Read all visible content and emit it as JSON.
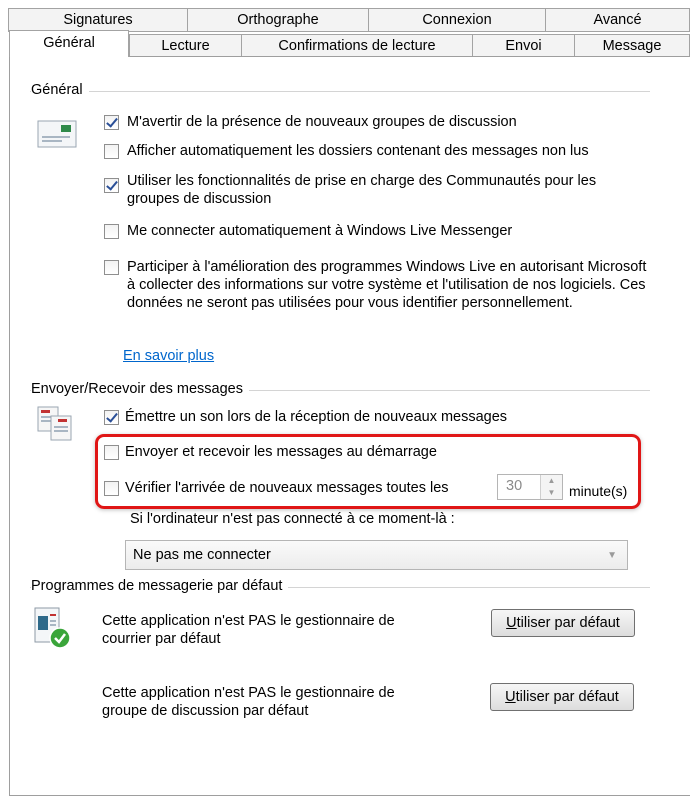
{
  "tabs_row1": [
    {
      "label": "Signatures"
    },
    {
      "label": "Orthographe"
    },
    {
      "label": "Connexion"
    },
    {
      "label": "Avancé"
    }
  ],
  "tabs_row2": [
    {
      "label": "Général"
    },
    {
      "label": "Lecture"
    },
    {
      "label": "Confirmations de lecture"
    },
    {
      "label": "Envoi"
    },
    {
      "label": "Message"
    }
  ],
  "general": {
    "title": "Général",
    "options": [
      {
        "label": "M'avertir de la présence de nouveaux groupes de discussion",
        "checked": true
      },
      {
        "label": "Afficher automatiquement les dossiers contenant des messages non lus",
        "checked": false
      },
      {
        "label": "Utiliser les fonctionnalités de prise en charge des Communautés pour les groupes de discussion",
        "checked": true
      },
      {
        "label": "Me connecter automatiquement à Windows Live Messenger",
        "checked": false
      },
      {
        "label": "Participer à l'amélioration des programmes Windows Live en autorisant Microsoft à collecter des informations sur votre système et l'utilisation de nos logiciels. Ces données ne seront pas utilisées pour vous identifier personnellement.",
        "checked": false
      }
    ],
    "learn_more": "En savoir plus"
  },
  "send_receive": {
    "title": "Envoyer/Recevoir des messages",
    "options": [
      {
        "label": "Émettre un son lors de la réception de nouveaux messages",
        "checked": true
      },
      {
        "label": "Envoyer et recevoir les messages au démarrage",
        "checked": false
      },
      {
        "label": "Vérifier l'arrivée de nouveaux messages toutes les",
        "checked": false
      }
    ],
    "interval_value": "30",
    "interval_unit": "minute(s)",
    "not_connected_label": "Si l'ordinateur n'est pas connecté à ce moment-là :",
    "not_connected_value": "Ne pas me connecter"
  },
  "default_programs": {
    "title": "Programmes de messagerie par défaut",
    "mail_text": "Cette application n'est PAS le gestionnaire de courrier par défaut",
    "news_text": "Cette application n'est PAS le gestionnaire de groupe de discussion par défaut",
    "button_label_u": "U",
    "button_label_rest": "tiliser par défaut"
  },
  "colors": {
    "highlight": "#e01616",
    "link": "#0066cc",
    "check": "#2a4f97"
  },
  "icons": [
    "newsgroup-icon",
    "send-receive-icon",
    "default-mail-icon",
    "check-badge-icon"
  ]
}
